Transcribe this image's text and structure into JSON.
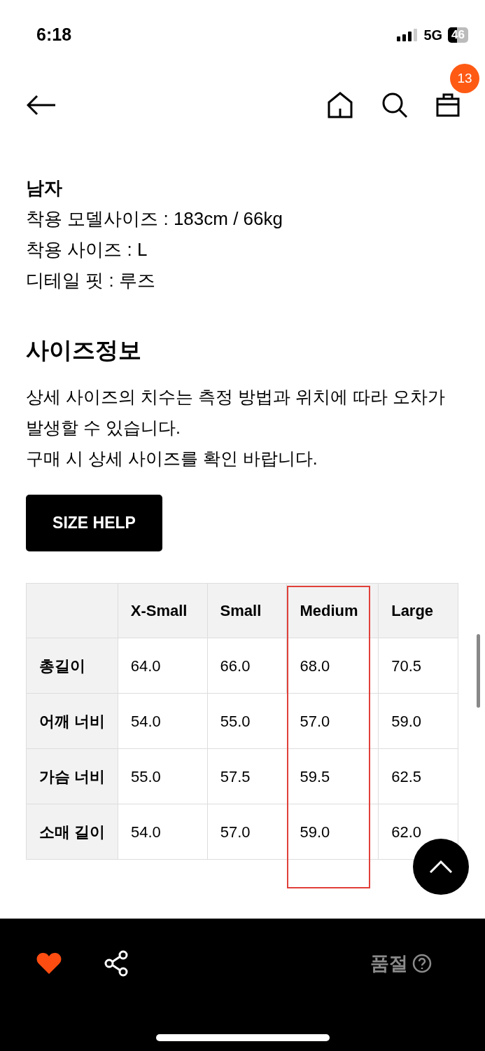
{
  "status_bar": {
    "time": "6:18",
    "network": "5G",
    "battery": "46"
  },
  "nav": {
    "cart_count": "13"
  },
  "model_info": {
    "gender": "남자",
    "lines": [
      "착용 모델사이즈 : 183cm / 66kg",
      "착용 사이즈 : L",
      "디테일 핏 : 루즈"
    ]
  },
  "size_info": {
    "title": "사이즈정보",
    "notes": [
      "상세 사이즈의 치수는 측정 방법과 위치에 따라 오차가 발생할 수 있습니다.",
      "구매 시 상세 사이즈를 확인 바랍니다."
    ],
    "help_button": "SIZE HELP"
  },
  "table": {
    "columns": [
      {
        "highlighted": false
      },
      {
        "label": "X-Small",
        "highlighted": false
      },
      {
        "label": "Small",
        "highlighted": false
      },
      {
        "label": "Medium",
        "highlighted": true
      },
      {
        "label": "Large",
        "highlighted": false
      }
    ],
    "rows": [
      [
        "총길이",
        "64.0",
        "66.0",
        "68.0",
        "70.5"
      ],
      [
        "어깨 너비",
        "54.0",
        "55.0",
        "57.0",
        "59.0"
      ],
      [
        "가슴 너비",
        "55.0",
        "57.5",
        "59.5",
        "62.5"
      ],
      [
        "소매 길이",
        "54.0",
        "57.0",
        "59.0",
        "62.0"
      ]
    ]
  },
  "bottom_bar": {
    "favorited": true,
    "status": "품절"
  }
}
